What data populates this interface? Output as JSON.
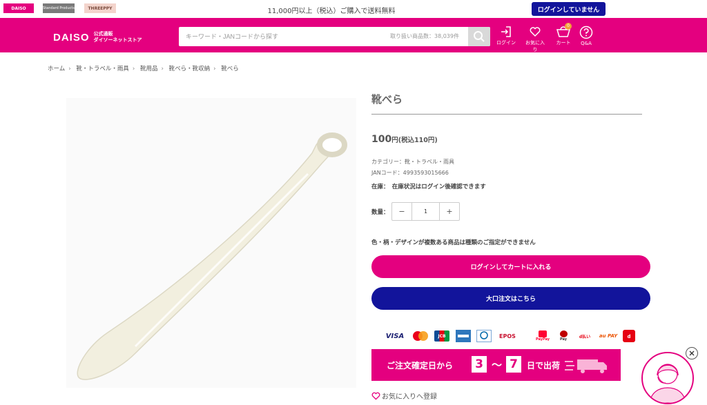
{
  "topbar": {
    "brand_tabs": [
      "DAISO",
      "Standard Products",
      "THREEPPY"
    ],
    "free_shipping": "11,000円以上（税込）ご購入で送料無料",
    "login_status": "ログインしていません"
  },
  "header": {
    "logo_word": "DAISO",
    "logo_line1": "公式通販",
    "logo_line2": "ダイソーネットストア",
    "search_placeholder": "キーワード・JANコードから探す",
    "search_count": "取り扱い商品数：38,039件",
    "icons": {
      "login": "ログイン",
      "favorites": "お気に入り",
      "cart": "カート",
      "cart_count": "0",
      "qa": "Q&A"
    }
  },
  "breadcrumb": [
    "ホーム",
    "靴・トラベル・雨具",
    "靴用品",
    "靴べら・靴収納",
    "靴べら"
  ],
  "product": {
    "title": "靴べら",
    "price": "100",
    "price_unit": "円(税込110円)",
    "category": "カテゴリー：靴・トラベル・雨具",
    "jan": "JANコード：4993593015666",
    "stock": "在庫：　在庫状況はログイン後確認できます",
    "qty_label": "数量：",
    "qty_minus": "−",
    "qty_value": "1",
    "qty_plus": "+",
    "notice": "色・柄・デザインが複数ある商品は種類のご指定ができません",
    "cart_button": "ログインしてカートに入れる",
    "bulk_button": "大口注文はこちら",
    "favorite": "お気に入りへ登録"
  },
  "payments": [
    "VISA",
    "JCB",
    "EPOS",
    "PayPay",
    "Pay",
    "d払い",
    "au PAY"
  ],
  "shipping_banner": {
    "prefix": "ご注文確定日から",
    "from": "3",
    "tilde": "〜",
    "to": "7",
    "suffix": "日で出荷"
  },
  "colors": {
    "brand_pink": "#e4007f",
    "navy": "#12149b"
  }
}
